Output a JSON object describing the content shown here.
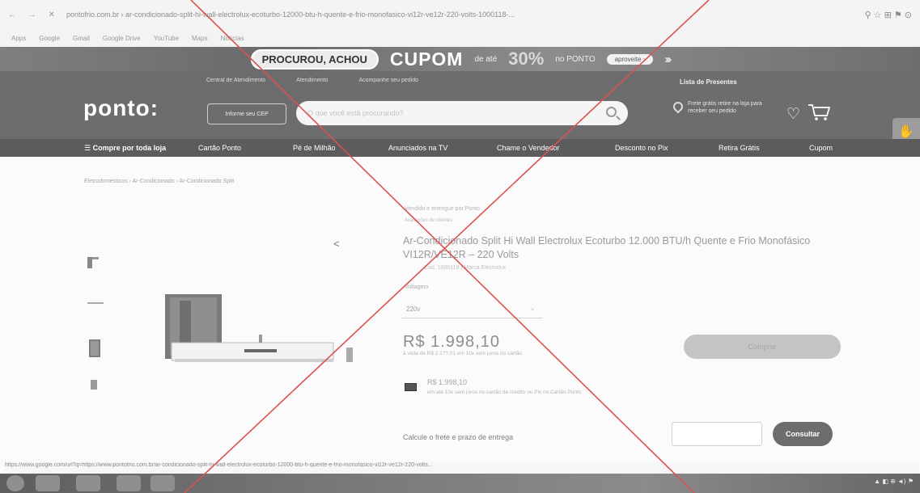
{
  "browser": {
    "nav_buttons": "← → ✕",
    "url": "pontofrio.com.br › ar-condicionado-split-hi-wall-electrolux-ecoturbo-12000-btu-h-quente-e-frio-monofasico-vi12r-ve12r-220-volts-1000118-...",
    "icons": "⚲   ☆   ⊞   ⚑   ⊙",
    "bookmarks": [
      "Apps",
      "Google",
      "Gmail",
      "Google Drive",
      "YouTube",
      "Maps",
      "Notícias"
    ]
  },
  "promo": {
    "pill": "PROCUROU, ACHOU",
    "cupom": "CUPOM",
    "de_ate": "de até",
    "pct": "30%",
    "no_ponto": "no PONTO",
    "button": "aproveite ›",
    "arrows": "›››"
  },
  "header": {
    "toplinks": [
      "Central de Atendimento",
      "Atendimento",
      "Acompanhe seu pedido"
    ],
    "gift_list": "Lista de Presentes",
    "logo": "ponto:",
    "cep_button": "Informe seu CEP",
    "search_placeholder": "O que você está procurando?",
    "pickup": "Frete grátis retire na loja para receber seu pedido"
  },
  "nav": {
    "items": [
      "☰  Compre por toda loja",
      "Cartão Ponto",
      "Pé de Milhão",
      "Anunciados na TV",
      "Chame o Vendedor",
      "Desconto no Pix",
      "Retira Grátis",
      "Cupom"
    ]
  },
  "product": {
    "breadcrumb": "Eletrodomésticos › Ar-Condicionado › Ar-Condicionado Split",
    "sold_by": "Vendido e entregue por Ponto",
    "rating": "Avaliações de clientes",
    "title": "Ar-Condicionado Split Hi Wall Electrolux Ecoturbo 12.000 BTU/h Quente e Frio Monofásico VI12R/VE12R – 220 Volts",
    "code": "Cód. 1000118 | Marca Electrolux",
    "voltage_label": "Voltagem",
    "voltage_value": "220v",
    "price": "R$ 1.998,10",
    "price_note": "à vista de R$ 2.1??,01   em 10x sem juros no cartão",
    "buy_button": "Comprar",
    "card_price": "R$ 1.998,10",
    "card_note": "em até 10x sem juros no cartão de crédito ou Pix no Cartão Ponto",
    "freight_label": "Calcule o frete e prazo de entrega",
    "cep_placeholder": "",
    "consult_button": "Consultar"
  },
  "status_bar": {
    "url": "https://www.google.com/url?q=https://www.pontofrio.com.br/ar-condicionado-split-hi-wall-electrolux-ecoturbo-12000-btu-h-quente-e-frio-monofasico-vi12r-ve12r-220-volts..."
  },
  "taskbar": {
    "tray": "▲  ◧  ⊕  ◄)  ⚑"
  },
  "colors": {
    "cross": "#d9534f",
    "header_bg": "#6d6d6d",
    "nav_bg": "#5c5c5c"
  }
}
